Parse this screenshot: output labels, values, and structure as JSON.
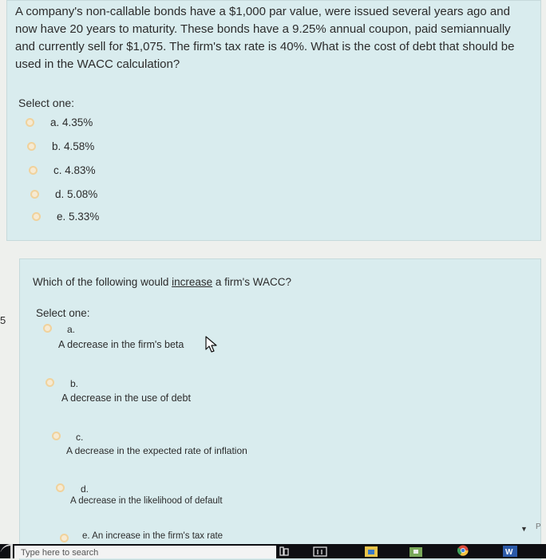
{
  "question1": {
    "text": "A company's non-callable bonds have a $1,000 par value, were issued several years ago and now have 20 years to maturity. These bonds have a 9.25% annual coupon, paid semiannually and currently sell for $1,075. The firm's tax rate is 40%. What is the cost of debt that should be used in the WACC calculation?",
    "select_label": "Select one:",
    "options": [
      "a. 4.35%",
      "b. 4.58%",
      "c. 4.83%",
      "d. 5.08%",
      "e. 5.33%"
    ]
  },
  "question2": {
    "text_before": "Which of the following would ",
    "text_emph": "increase",
    "text_after": " a firm's WACC?",
    "select_label": "Select one:",
    "options": [
      {
        "letter": "a.",
        "text": "A decrease in the firm's beta"
      },
      {
        "letter": "b.",
        "text": "A decrease in the use of debt"
      },
      {
        "letter": "c.",
        "text": "A decrease in the expected rate of inflation"
      },
      {
        "letter": "d.",
        "text": "A decrease in the likelihood of default"
      },
      {
        "letter": "",
        "text": "e. An increase in the firm's tax rate"
      }
    ]
  },
  "side_number": "5",
  "edge_text": "P",
  "taskbar": {
    "search_placeholder": "Type here to search"
  },
  "colors": {
    "card_bg": "#d9ecee",
    "page_bg": "#eef0ed",
    "radio_ring": "#f0d29c",
    "taskbar_bg": "#0e0e12"
  },
  "icons": [
    "cursor-arrow-icon",
    "chevron-down-icon",
    "windows-start-icon",
    "task-view-icon",
    "file-explorer-icon",
    "store-icon",
    "chrome-icon",
    "word-icon"
  ]
}
